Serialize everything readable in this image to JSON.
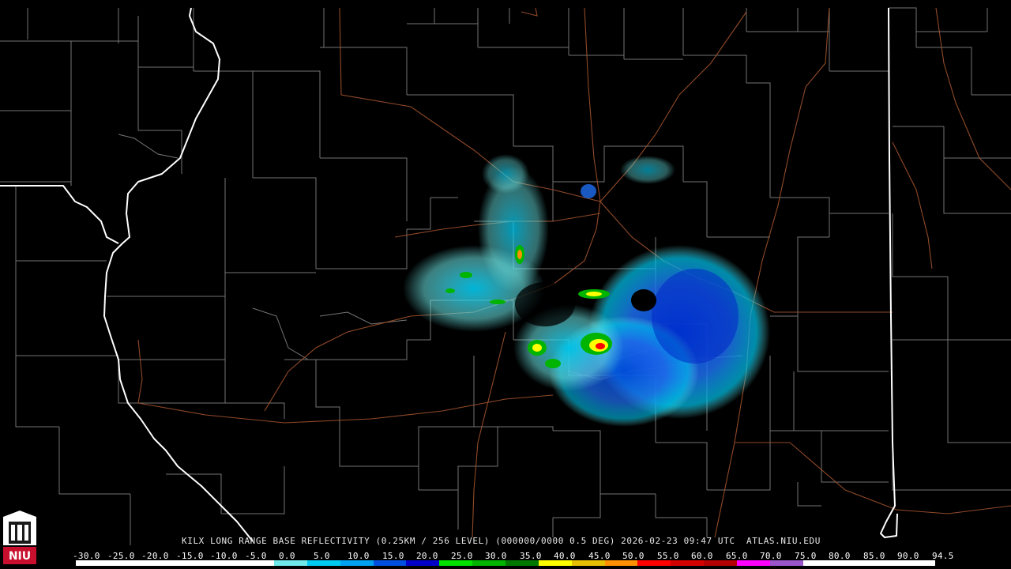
{
  "product_caption": "KILX LONG RANGE BASE REFLECTIVITY (0.25KM / 256 LEVEL) (000000/0000 0.5 DEG) 2026-02-23 09:47 UTC  ATLAS.NIU.EDU",
  "logo": {
    "text": "NIU",
    "color": "#c8102e"
  },
  "legend": {
    "ticks": [
      "-30.0",
      "-25.0",
      "-20.0",
      "-15.0",
      "-10.0",
      "-5.0",
      "0.0",
      "5.0",
      "10.0",
      "15.0",
      "20.0",
      "25.0",
      "30.0",
      "35.0",
      "40.0",
      "45.0",
      "50.0",
      "55.0",
      "60.0",
      "65.0",
      "70.0",
      "75.0",
      "80.0",
      "85.0",
      "90.0",
      "94.5"
    ],
    "colors": [
      "#ffffff",
      "#ffffff",
      "#ffffff",
      "#ffffff",
      "#ffffff",
      "#ffffff",
      "#6ee8e8",
      "#00c8f0",
      "#00a0f0",
      "#0050e0",
      "#0000c8",
      "#00e000",
      "#00b400",
      "#007800",
      "#ffff00",
      "#e6c000",
      "#ff9000",
      "#ff0000",
      "#d40000",
      "#b40000",
      "#ff00ff",
      "#9955c9",
      "#ffffff",
      "#ffffff",
      "#ffffff",
      "#ffffff"
    ]
  },
  "map_colors": {
    "county_lines": "#8a8a8a",
    "state_lines": "#ffffff",
    "highways": "#a0522d"
  }
}
